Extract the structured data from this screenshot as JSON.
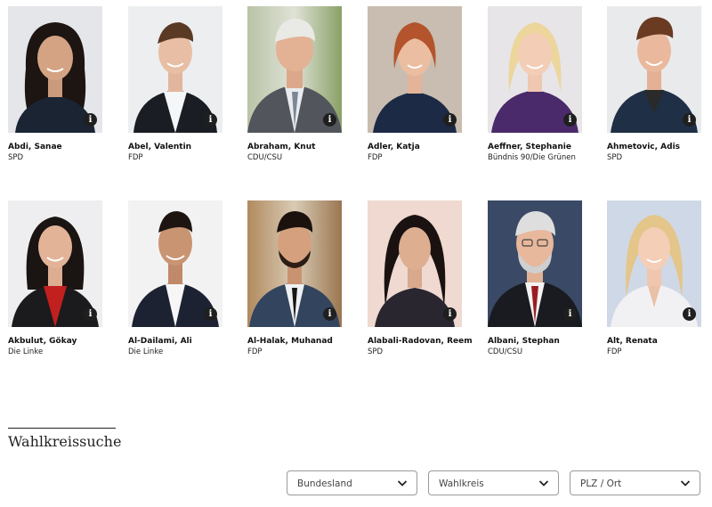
{
  "members": [
    {
      "name": "Abdi, Sanae",
      "party": "SPD"
    },
    {
      "name": "Abel, Valentin",
      "party": "FDP"
    },
    {
      "name": "Abraham, Knut",
      "party": "CDU/CSU"
    },
    {
      "name": "Adler, Katja",
      "party": "FDP"
    },
    {
      "name": "Aeffner, Stephanie",
      "party": "Bündnis 90/Die Grünen"
    },
    {
      "name": "Ahmetovic, Adis",
      "party": "SPD"
    },
    {
      "name": "Akbulut, Gökay",
      "party": "Die Linke"
    },
    {
      "name": "Al-Dailami, Ali",
      "party": "Die Linke"
    },
    {
      "name": "Al-Halak, Muhanad",
      "party": "FDP"
    },
    {
      "name": "Alabali-Radovan, Reem",
      "party": "SPD"
    },
    {
      "name": "Albani, Stephan",
      "party": "CDU/CSU"
    },
    {
      "name": "Alt, Renata",
      "party": "FDP"
    }
  ],
  "info_glyph": "i",
  "search": {
    "title": "Wahlkreissuche",
    "filters": [
      {
        "label": "Bundesland"
      },
      {
        "label": "Wahlkreis"
      },
      {
        "label": "PLZ / Ort"
      }
    ]
  },
  "icons": {
    "info": "info-icon",
    "dropdown": "chevron-down-icon"
  }
}
